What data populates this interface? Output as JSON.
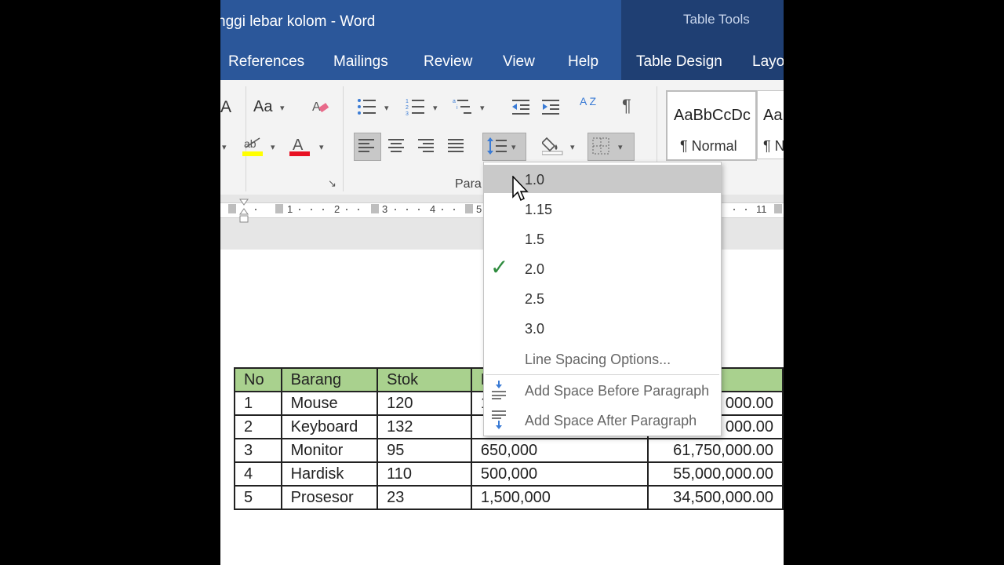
{
  "title_bar": {
    "doc_title": "nggi lebar kolom  -  Word",
    "context_title": "Table Tools"
  },
  "tabs": [
    "References",
    "Mailings",
    "Review",
    "View",
    "Help",
    "Table Design",
    "Layo"
  ],
  "ribbon": {
    "paragraph_group_label": "Para",
    "font_group_fragment": "A",
    "change_case_label": "Aa",
    "sort_label": "A Z",
    "pilcrow": "¶",
    "highlight_label": "ab",
    "font_color_label": "A",
    "styles": [
      {
        "sample": "AaBbCcDc",
        "name": "¶ Normal"
      },
      {
        "sample": "Aa",
        "name": "¶ N"
      }
    ]
  },
  "ruler": {
    "labels": [
      "1",
      "2",
      "3",
      "4",
      "5",
      "11"
    ]
  },
  "line_spacing_menu": {
    "items": [
      "1.0",
      "1.15",
      "1.5",
      "2.0",
      "2.5",
      "3.0",
      "Line Spacing Options..."
    ],
    "checked_item": "2.0",
    "hovered_item": "1.0",
    "add_space_before": "Add Space Before Paragraph",
    "add_space_after": "Add Space After Paragraph"
  },
  "table": {
    "headers": [
      "No",
      "Barang",
      "Stok",
      "H",
      ""
    ],
    "rows": [
      [
        "1",
        "Mouse",
        "120",
        "1",
        "000.00"
      ],
      [
        "2",
        "Keyboard",
        "132",
        "",
        "000.00"
      ],
      [
        "3",
        "Monitor",
        "95",
        "650,000",
        "61,750,000.00"
      ],
      [
        "4",
        "Hardisk",
        "110",
        "500,000",
        "55,000,000.00"
      ],
      [
        "5",
        "Prosesor",
        "23",
        "1,500,000",
        "34,500,000.00"
      ]
    ]
  },
  "colors": {
    "title_bar": "#2b579a",
    "context_tab": "#1f3f73",
    "table_header": "#a9d18e",
    "check": "#2e8b3e",
    "highlight": "#ffff00",
    "font_color": "#e81123"
  }
}
